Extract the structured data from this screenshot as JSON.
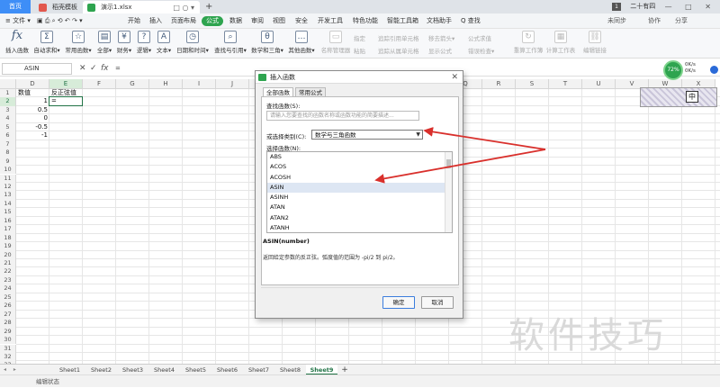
{
  "titlebar": {
    "home_tab": "首页",
    "tabs": [
      {
        "label": "稻壳模板",
        "color": "#e2574c"
      },
      {
        "label": "演示1.xlsx",
        "color": "#2ea44f"
      }
    ],
    "new_tab": "+",
    "tab_controls": "□ ○ ▾",
    "user_badge": "1",
    "user_name": "二十有四",
    "window_controls": "— □ ✕"
  },
  "menubar": {
    "file_label": "≡ 文件 ▾",
    "items": [
      "开始",
      "插入",
      "页面布局",
      "公式",
      "数据",
      "审阅",
      "视图",
      "安全",
      "开发工具",
      "特色功能",
      "智能工具箱",
      "文档助手"
    ],
    "active": "公式",
    "search": "Q 查找",
    "sync": "未同步",
    "collab": "协作",
    "share": "分享"
  },
  "ribbon": {
    "items": [
      "插入函数",
      "自动求和▾",
      "常用函数▾",
      "全部▾",
      "财务▾",
      "逻辑▾",
      "文本▾",
      "日期和时间▾",
      "查找与引用▾",
      "数学和三角▾",
      "其他函数▾",
      "名称管理器",
      "粘贴",
      "追踪引用单元格",
      "移去箭头▾",
      "显示公式",
      "错误检查▾",
      "重算工作簿",
      "计算工作表",
      "编辑链接"
    ],
    "small": [
      "指定",
      "追踪从属单元格",
      "公式求值"
    ],
    "fx_icon": "fx"
  },
  "formulabar": {
    "name_box": "ASIN",
    "cancel": "✕",
    "confirm": "✓",
    "fx": "fx",
    "formula": "="
  },
  "grid": {
    "columns": [
      "D",
      "E",
      "F",
      "G",
      "H",
      "I",
      "J",
      "K",
      "L",
      "M",
      "N",
      "O",
      "P",
      "Q",
      "R",
      "S",
      "T",
      "U",
      "V",
      "W",
      "X"
    ],
    "active_column": "E",
    "active_row": 2,
    "rows": 33,
    "cells": {
      "D1": "数值",
      "E1": "反正弦值",
      "D2": "1",
      "E2": "=",
      "D3": "0.5",
      "D4": "0",
      "D5": "-0.5",
      "D6": "-1"
    }
  },
  "sheets": {
    "nav": "◂ ▸",
    "tabs": [
      "Sheet1",
      "Sheet2",
      "Sheet3",
      "Sheet4",
      "Sheet5",
      "Sheet6",
      "Sheet7",
      "Sheet8",
      "Sheet9"
    ],
    "active": "Sheet9",
    "add": "+"
  },
  "status": {
    "text": "编辑状态"
  },
  "dialog": {
    "title": "插入函数",
    "close": "✕",
    "tabs": [
      "全部函数",
      "常用公式"
    ],
    "search_label": "查找函数(S):",
    "search_placeholder": "请输入您要查找的函数名称或函数功能的简要描述...",
    "category_label": "或选择类别(C):",
    "category_value": "数学与三角函数",
    "list_label": "选择函数(N):",
    "functions": [
      "ABS",
      "ACOS",
      "ACOSH",
      "ASIN",
      "ASINH",
      "ATAN",
      "ATAN2",
      "ATANH"
    ],
    "selected_function": "ASIN",
    "signature": "ASIN(number)",
    "description": "返回给定参数的反正弦。弧度值的范围为 -pi/2 到 pi/2。",
    "ok": "确定",
    "cancel": "取消"
  },
  "widgets": {
    "score": "72%",
    "speed_up": "0K/s",
    "speed_down": "0K/s",
    "ime": "中"
  },
  "watermark": "软件技巧",
  "colors": {
    "accent": "#2ea44f",
    "arrow": "#d9302c",
    "selection": "#217346"
  }
}
